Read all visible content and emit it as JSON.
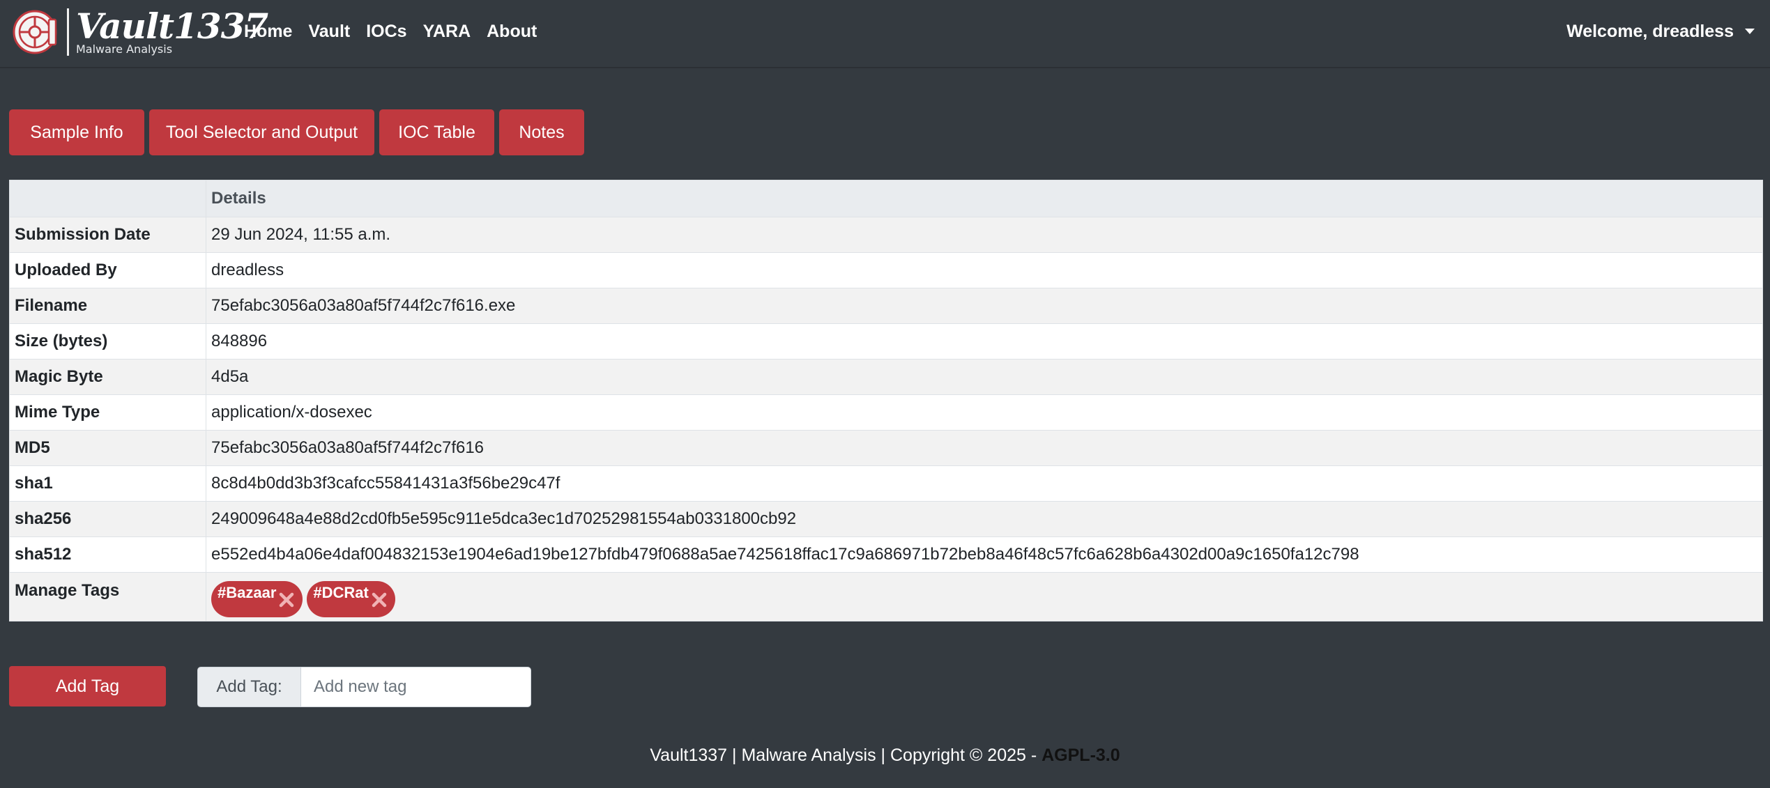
{
  "navbar": {
    "brand_title": "Vault1337",
    "brand_subtitle": "Malware Analysis",
    "logo_icon": "vault-door-icon",
    "links": [
      {
        "label": "Home"
      },
      {
        "label": "Vault"
      },
      {
        "label": "IOCs"
      },
      {
        "label": "YARA"
      },
      {
        "label": "About"
      }
    ],
    "welcome": "Welcome, dreadless"
  },
  "tabs": [
    {
      "label": "Sample Info"
    },
    {
      "label": "Tool Selector and Output"
    },
    {
      "label": "IOC Table"
    },
    {
      "label": "Notes"
    }
  ],
  "table": {
    "header_blank": "",
    "header_details": "Details",
    "rows": [
      {
        "key": "Submission Date",
        "value": "29 Jun 2024, 11:55 a.m."
      },
      {
        "key": "Uploaded By",
        "value": "dreadless"
      },
      {
        "key": "Filename",
        "value": "75efabc3056a03a80af5f744f2c7f616.exe"
      },
      {
        "key": "Size (bytes)",
        "value": "848896"
      },
      {
        "key": "Magic Byte",
        "value": "4d5a"
      },
      {
        "key": "Mime Type",
        "value": "application/x-dosexec"
      },
      {
        "key": "MD5",
        "value": "75efabc3056a03a80af5f744f2c7f616"
      },
      {
        "key": "sha1",
        "value": "8c8d4b0dd3b3f3cafcc55841431a3f56be29c47f"
      },
      {
        "key": "sha256",
        "value": "249009648a4e88d2cd0fb5e595c911e5dca3ec1d70252981554ab0331800cb92"
      },
      {
        "key": "sha512",
        "value": "e552ed4b4a06e4daf004832153e1904e6ad19be127bfdb479f0688a5ae7425618ffac17c9a686971b72beb8a46f48c57fc6a628b6a4302d00a9c1650fa12c798"
      }
    ],
    "tags_key": "Manage Tags",
    "tags": [
      {
        "label": "#Bazaar"
      },
      {
        "label": "#DCRat"
      }
    ]
  },
  "add_tag": {
    "button_label": "Add Tag",
    "input_label": "Add Tag:",
    "input_placeholder": "Add new tag",
    "input_value": ""
  },
  "footer": {
    "text": "Vault1337 | Malware Analysis | Copyright © 2025 - ",
    "license": "AGPL-3.0"
  },
  "colors": {
    "background": "#343a40",
    "accent": "#c0393f",
    "table_header": "#e9ecef",
    "row_stripe": "#f2f2f2"
  }
}
